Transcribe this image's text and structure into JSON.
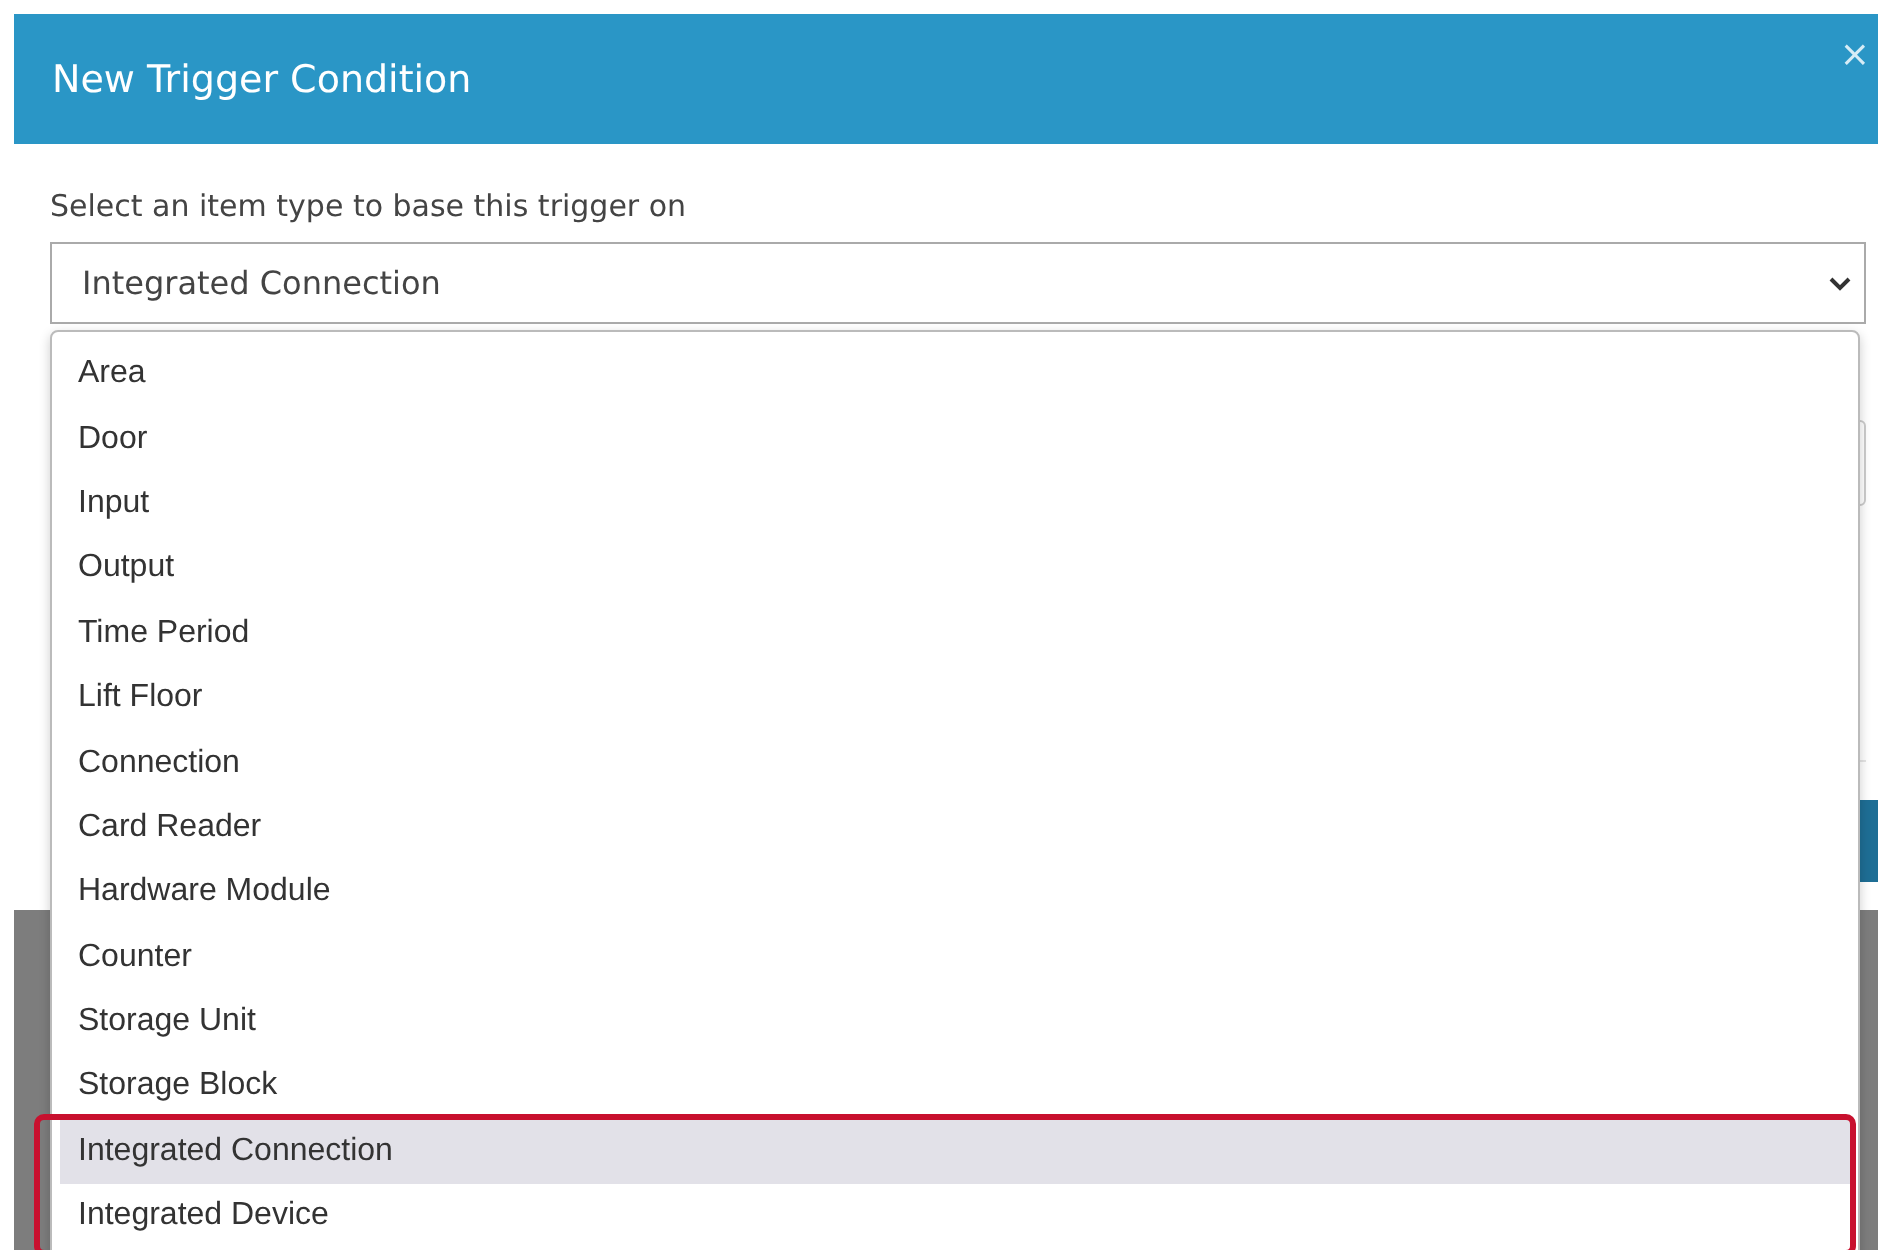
{
  "dialog": {
    "title": "New Trigger Condition",
    "close": "×"
  },
  "field": {
    "label": "Select an item type to base this trigger on",
    "value": "Integrated Connection"
  },
  "options": [
    {
      "label": "Area",
      "selected": false,
      "highlighted": false
    },
    {
      "label": "Door",
      "selected": false,
      "highlighted": false
    },
    {
      "label": "Input",
      "selected": false,
      "highlighted": false
    },
    {
      "label": "Output",
      "selected": false,
      "highlighted": false
    },
    {
      "label": "Time Period",
      "selected": false,
      "highlighted": false
    },
    {
      "label": "Lift Floor",
      "selected": false,
      "highlighted": false
    },
    {
      "label": "Connection",
      "selected": false,
      "highlighted": false
    },
    {
      "label": "Card Reader",
      "selected": false,
      "highlighted": false
    },
    {
      "label": "Hardware Module",
      "selected": false,
      "highlighted": false
    },
    {
      "label": "Counter",
      "selected": false,
      "highlighted": false
    },
    {
      "label": "Storage Unit",
      "selected": false,
      "highlighted": false
    },
    {
      "label": "Storage Block",
      "selected": false,
      "highlighted": false
    },
    {
      "label": "Integrated Connection",
      "selected": true,
      "highlighted": true
    },
    {
      "label": "Integrated Device",
      "selected": false,
      "highlighted": true
    }
  ]
}
